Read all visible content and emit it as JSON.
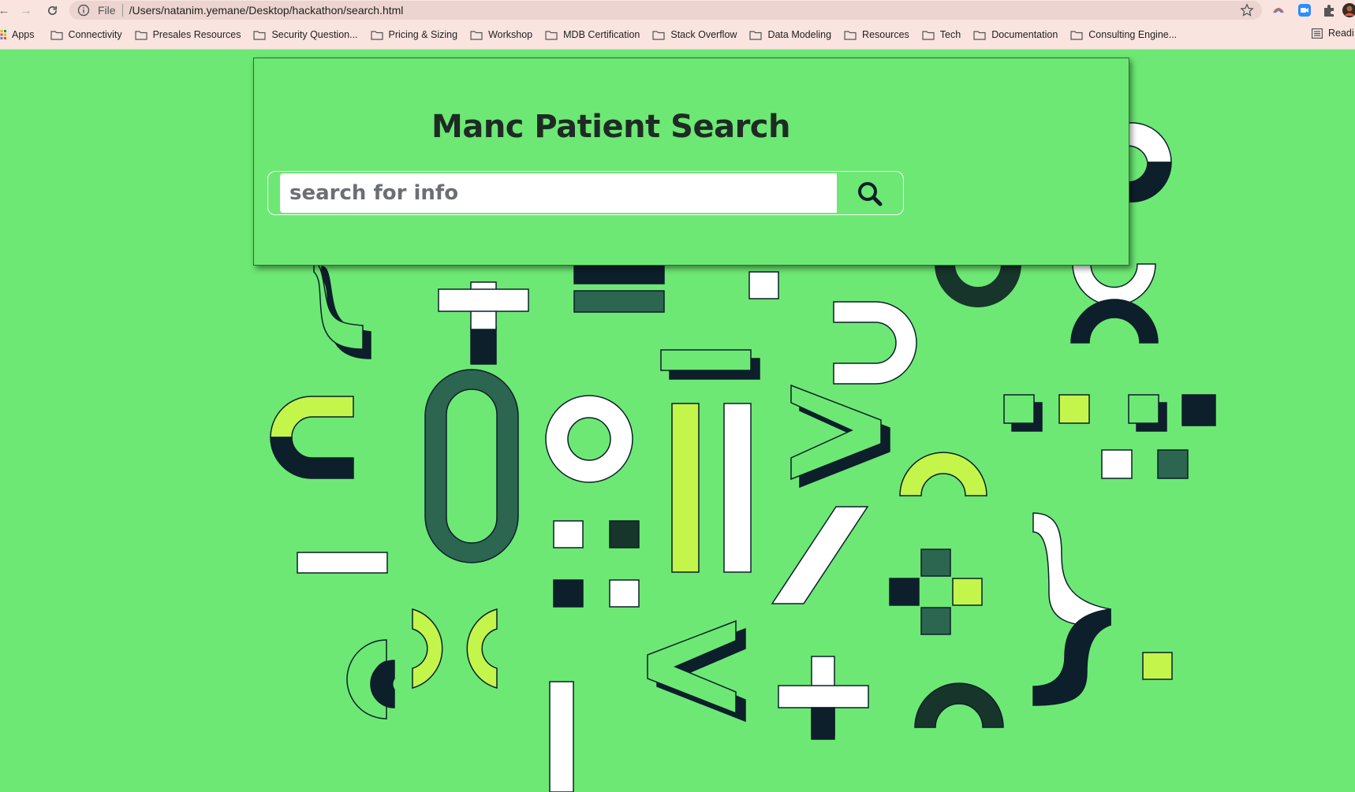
{
  "browser": {
    "url_scheme": "File",
    "url": "/Users/natanim.yemane/Desktop/hackathon/search.html",
    "bookmarks": [
      "Apps",
      "Connectivity",
      "Presales Resources",
      "Security Question...",
      "Pricing & Sizing",
      "Workshop",
      "MDB Certification",
      "Stack Overflow",
      "Data Modeling",
      "Resources",
      "Tech",
      "Documentation",
      "Consulting Engine..."
    ],
    "reading_list_label": "Readi"
  },
  "page": {
    "title": "Manc Patient Search",
    "search": {
      "placeholder": "search for info",
      "value": ""
    },
    "icons": {
      "search_button": "magnifier-icon"
    }
  },
  "colors": {
    "background": "#6de874",
    "white": "#ffffff",
    "dark_navy": "#0c1f2b",
    "forest_green": "#2c6550",
    "deep_green": "#17352b",
    "lime": "#c4f54a",
    "title_text": "#1e2b24"
  }
}
